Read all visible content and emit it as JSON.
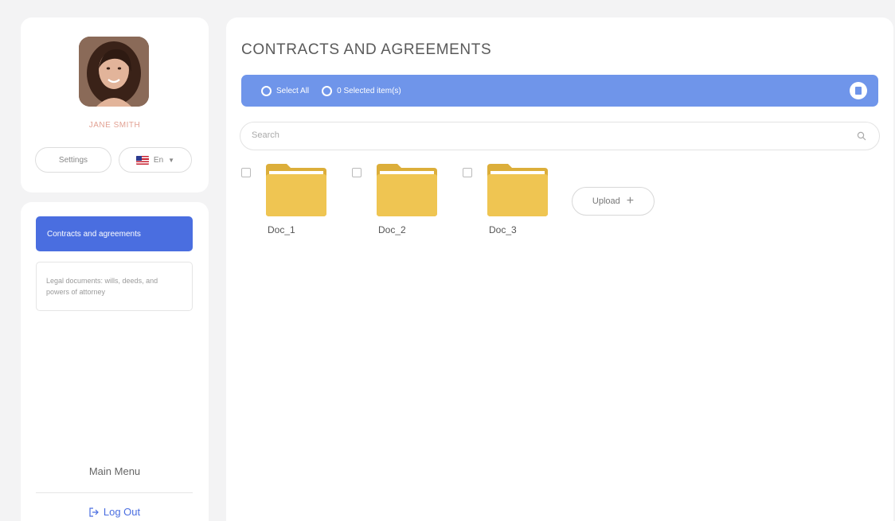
{
  "user": {
    "name": "JANE SMITH"
  },
  "profile": {
    "settings_label": "Settings",
    "language_label": "En"
  },
  "sidebar": {
    "items": [
      {
        "label": "Contracts and agreements",
        "active": true
      },
      {
        "label": "Legal documents: wills, deeds, and powers of attorney",
        "active": false
      }
    ],
    "main_menu_label": "Main Menu",
    "logout_label": "Log Out"
  },
  "main": {
    "title": "CONTRACTS AND AGREEMENTS",
    "select_all_label": "Select All",
    "selected_items_label": "0 Selected item(s)",
    "search_placeholder": "Search",
    "files": [
      {
        "name": "Doc_1",
        "checked": false
      },
      {
        "name": "Doc_2",
        "checked": false
      },
      {
        "name": "Doc_3",
        "checked": false
      }
    ],
    "upload_label": "Upload"
  },
  "colors": {
    "accent": "#4a6ee0",
    "select_bar": "#6f95ea",
    "folder": "#efc552",
    "user_name": "#e2a193"
  },
  "icons": {
    "search": "search-icon",
    "trash": "trash-icon",
    "logout": "logout-icon",
    "folder": "folder-icon",
    "plus": "plus-icon",
    "flag": "us-flag-icon"
  }
}
